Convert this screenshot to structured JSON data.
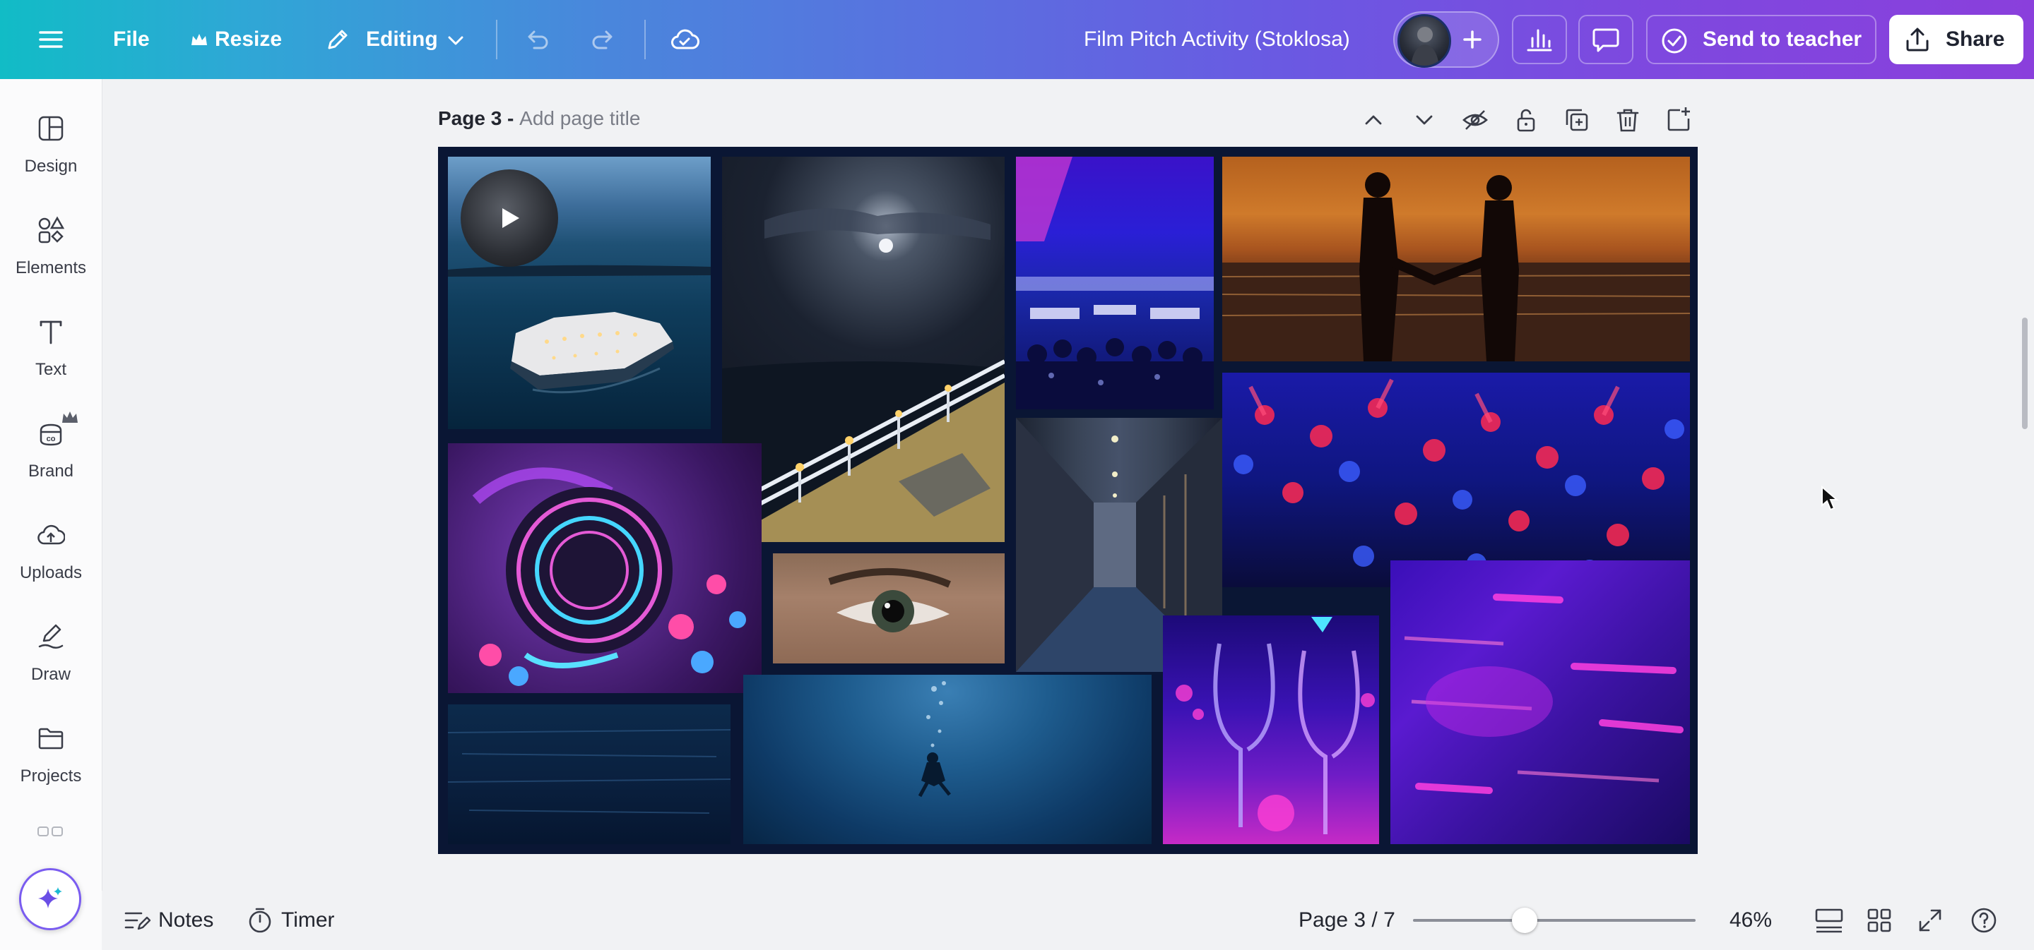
{
  "topbar": {
    "menu_icon": "hamburger-icon",
    "file_label": "File",
    "resize_label": "Resize",
    "editing_label": "Editing",
    "document_title": "Film Pitch Activity (Stoklosa)",
    "send_label": "Send to teacher",
    "share_label": "Share",
    "icons": [
      "crown-icon",
      "pencil-icon",
      "chevron-down-icon",
      "undo-icon",
      "redo-icon",
      "cloud-saved-icon",
      "avatar",
      "plus-icon",
      "chart-icon",
      "comment-icon",
      "check-circle-icon",
      "share-upload-icon"
    ]
  },
  "sidebar": {
    "items": [
      {
        "label": "Design",
        "icon": "design-icon"
      },
      {
        "label": "Elements",
        "icon": "elements-icon"
      },
      {
        "label": "Text",
        "icon": "text-icon"
      },
      {
        "label": "Brand",
        "icon": "brand-icon"
      },
      {
        "label": "Uploads",
        "icon": "upload-cloud-icon"
      },
      {
        "label": "Draw",
        "icon": "draw-icon"
      },
      {
        "label": "Projects",
        "icon": "folder-icon"
      }
    ],
    "magic_icon": "sparkle-icon"
  },
  "page": {
    "number_label": "Page 3 -",
    "title_placeholder": "Add page title",
    "tools": [
      "chevron-up-icon",
      "chevron-down-icon",
      "hide-icon",
      "lock-icon",
      "duplicate-icon",
      "trash-icon",
      "add-page-icon"
    ],
    "video_icon": "play-icon"
  },
  "bottombar": {
    "notes_label": "Notes",
    "timer_label": "Timer",
    "page_indicator": "Page 3 / 7",
    "zoom_label": "46%",
    "zoom_level": 0.46,
    "icons": [
      "notes-icon",
      "timer-icon",
      "grid-view-icon",
      "thumbnails-icon",
      "fullscreen-icon",
      "help-icon"
    ]
  },
  "colors": {
    "canvas_bg": "#0a1634",
    "accent_teal": "#11bcc6",
    "accent_purple": "#8a3fdc"
  }
}
